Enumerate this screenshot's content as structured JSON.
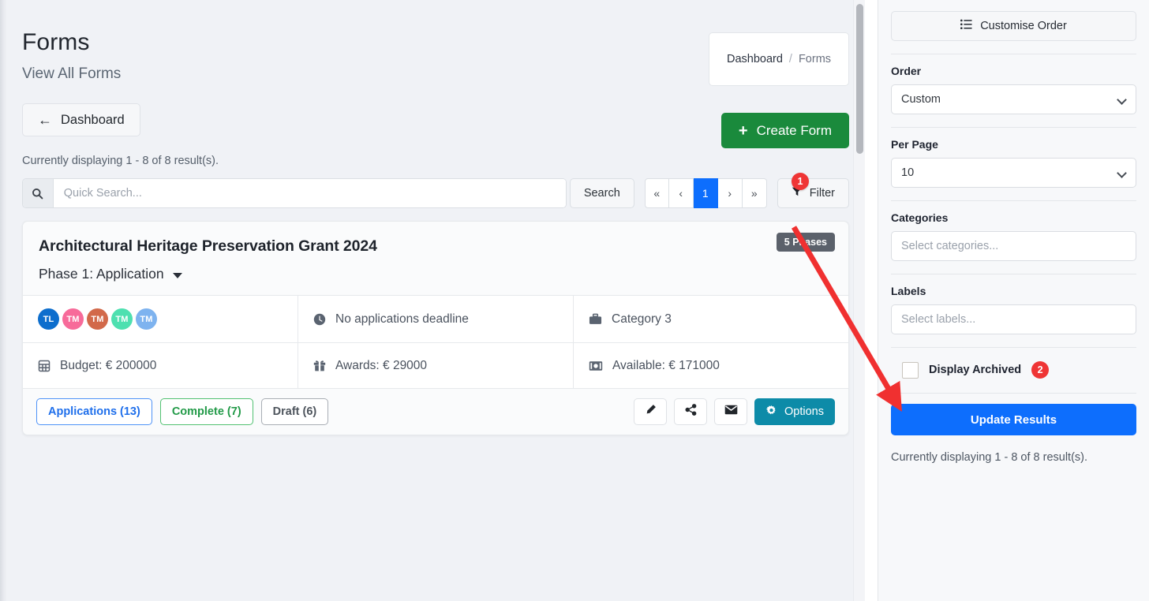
{
  "page": {
    "title": "Forms",
    "subtitle": "View All Forms",
    "results_text": "Currently displaying 1 - 8 of 8 result(s)."
  },
  "breadcrumb": {
    "parent": "Dashboard",
    "separator": "/",
    "current": "Forms"
  },
  "toolbar": {
    "dashboard_label": "Dashboard",
    "back_arrow": "←",
    "create_label": "Create Form",
    "create_plus": "+",
    "create_color": "#1a8a3c"
  },
  "search": {
    "placeholder": "Quick Search...",
    "value": "",
    "button_label": "Search",
    "filter_label": "Filter",
    "icon": "search-icon"
  },
  "pagination": {
    "first": "«",
    "prev": "‹",
    "pages": [
      "1"
    ],
    "next": "›",
    "last": "»",
    "active_page": "1",
    "active_color": "#0d6efd"
  },
  "form_card": {
    "title": "Architectural Heritage Preservation Grant 2024",
    "phase": "Phase 1: Application",
    "phases_badge": "5 Phases",
    "avatars": [
      {
        "initials": "TL",
        "color": "#0d6ecd"
      },
      {
        "initials": "TM",
        "color": "#f76b9a"
      },
      {
        "initials": "TM",
        "color": "#d2694a"
      },
      {
        "initials": "TM",
        "color": "#4ee0b0"
      },
      {
        "initials": "TM",
        "color": "#7eb3ef"
      }
    ],
    "deadline": "No applications deadline",
    "category": "Category 3",
    "budget": "Budget: € 200000",
    "awards": "Awards: € 29000",
    "available": "Available: € 171000",
    "tags": [
      {
        "label": "Applications (13)",
        "style": "blue"
      },
      {
        "label": "Complete (7)",
        "style": "green"
      },
      {
        "label": "Draft (6)",
        "style": "gray"
      }
    ],
    "actions": [
      {
        "name": "edit-icon-button",
        "icon": "pencil-icon"
      },
      {
        "name": "share-icon-button",
        "icon": "share-icon"
      },
      {
        "name": "email-icon-button",
        "icon": "envelope-icon"
      }
    ],
    "options_label": "Options",
    "options_color": "#0d8ba8"
  },
  "sidebar": {
    "customise_label": "Customise Order",
    "order_label": "Order",
    "order_value": "Custom",
    "order_options": [
      "Custom"
    ],
    "per_page_label": "Per Page",
    "per_page_value": "10",
    "per_page_options": [
      "10"
    ],
    "categories_label": "Categories",
    "categories_placeholder": "Select categories...",
    "labels_label": "Labels",
    "labels_placeholder": "Select labels...",
    "archived_label": "Display Archived",
    "archived_checked": false,
    "update_label": "Update Results",
    "update_color": "#0d6efd",
    "results_text": "Currently displaying 1 - 8 of 8 result(s)."
  },
  "annotations": {
    "badge_color": "#ef3535",
    "arrow_color": "#f03030",
    "markers": [
      {
        "number": "1",
        "target": "filter-button"
      },
      {
        "number": "2",
        "target": "display-archived-checkbox"
      }
    ]
  }
}
